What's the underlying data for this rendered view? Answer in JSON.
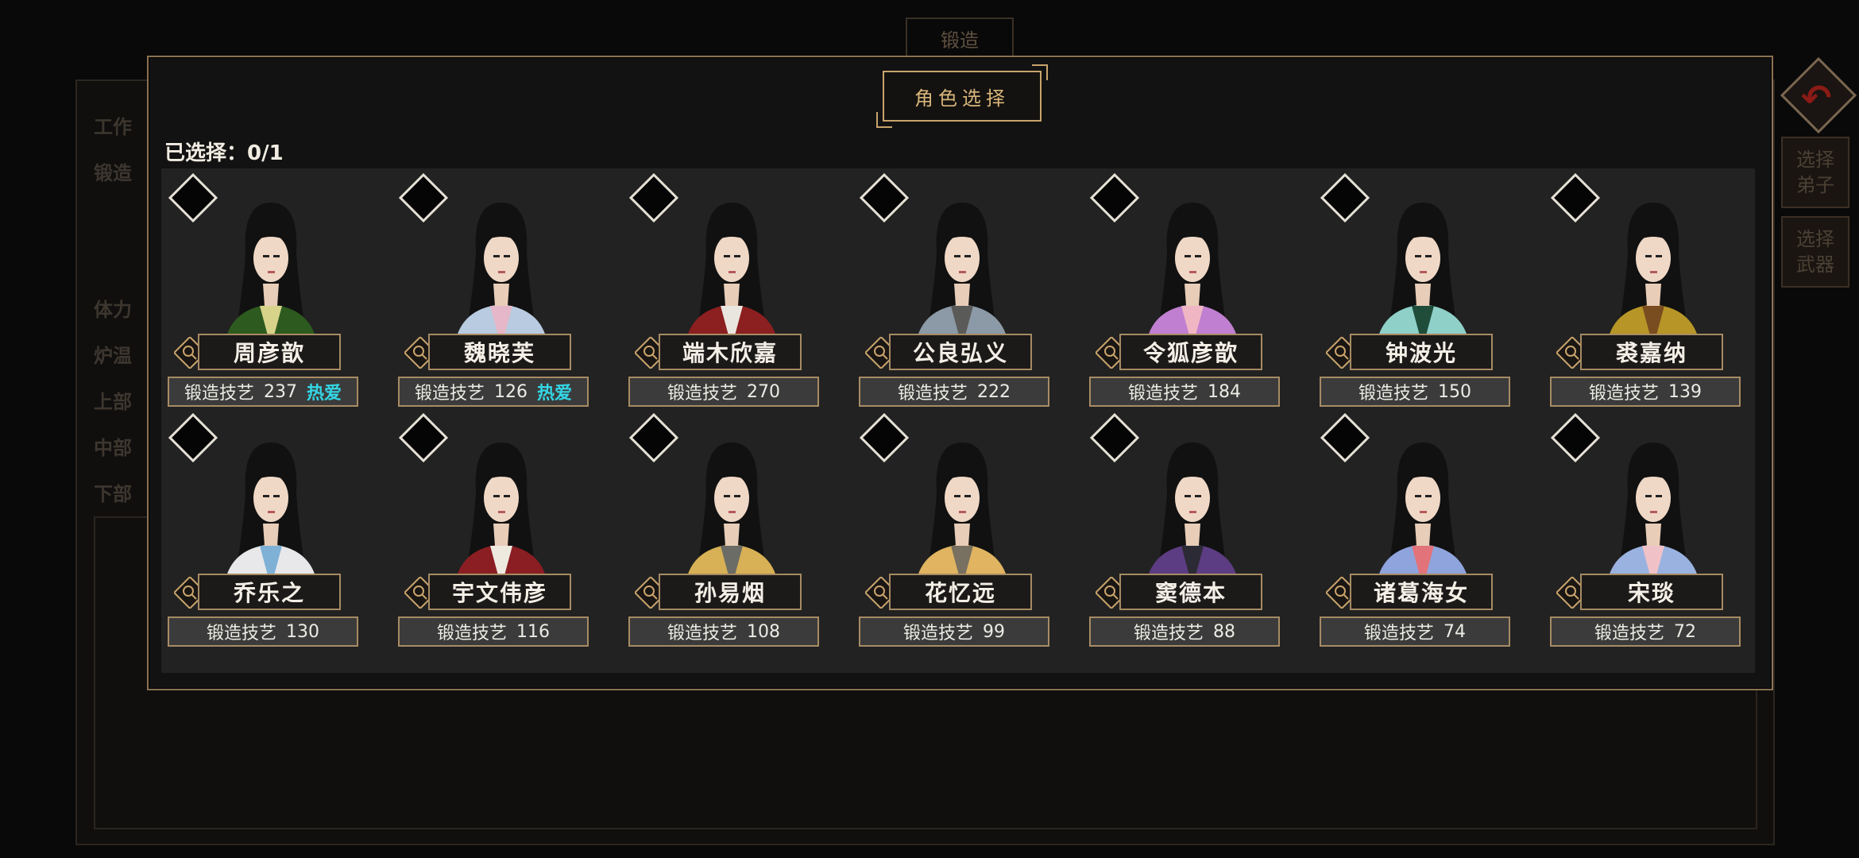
{
  "background": {
    "title": "锻造",
    "labels": [
      "工作",
      "锻造",
      "体力",
      "炉温",
      "上部",
      "中部",
      "下部"
    ],
    "side_buttons": [
      "选择\n弟子",
      "选择\n武器"
    ]
  },
  "modal": {
    "title": "角色选择",
    "selected_label": "已选择：0/1",
    "skill_label": "锻造技艺",
    "hot_label": "热爱"
  },
  "characters": [
    {
      "name": "周彦歆",
      "skill": "237",
      "hot": true,
      "robe": "#2d5a1f",
      "inner": "#d7d38a"
    },
    {
      "name": "魏晓芙",
      "skill": "126",
      "hot": true,
      "robe": "#b9cbe0",
      "inner": "#e5b7c8"
    },
    {
      "name": "端木欣嘉",
      "skill": "270",
      "hot": false,
      "robe": "#8c1f1f",
      "inner": "#e9e6df"
    },
    {
      "name": "公良弘义",
      "skill": "222",
      "hot": false,
      "robe": "#8b9aa6",
      "inner": "#5a5a58"
    },
    {
      "name": "令狐彦歆",
      "skill": "184",
      "hot": false,
      "robe": "#c07fd0",
      "inner": "#f0b6c4"
    },
    {
      "name": "钟波光",
      "skill": "150",
      "hot": false,
      "robe": "#8fd0c8",
      "inner": "#1f4d3a"
    },
    {
      "name": "裘嘉纳",
      "skill": "139",
      "hot": false,
      "robe": "#b79627",
      "inner": "#7a4d20"
    },
    {
      "name": "乔乐之",
      "skill": "130",
      "hot": false,
      "robe": "#e8e8ea",
      "inner": "#7fb1d6"
    },
    {
      "name": "宇文伟彦",
      "skill": "116",
      "hot": false,
      "robe": "#8a1e22",
      "inner": "#eeeae0"
    },
    {
      "name": "孙易烟",
      "skill": "108",
      "hot": false,
      "robe": "#d8b055",
      "inner": "#6c6c66"
    },
    {
      "name": "花忆远",
      "skill": "99",
      "hot": false,
      "robe": "#e0b460",
      "inner": "#787060"
    },
    {
      "name": "窦德本",
      "skill": "88",
      "hot": false,
      "robe": "#5c3c82",
      "inner": "#2c2a34"
    },
    {
      "name": "诸葛海女",
      "skill": "74",
      "hot": false,
      "robe": "#8fa4dc",
      "inner": "#e2737a"
    },
    {
      "name": "宋琰",
      "skill": "72",
      "hot": false,
      "robe": "#9ab2e0",
      "inner": "#f0c2c8"
    }
  ]
}
